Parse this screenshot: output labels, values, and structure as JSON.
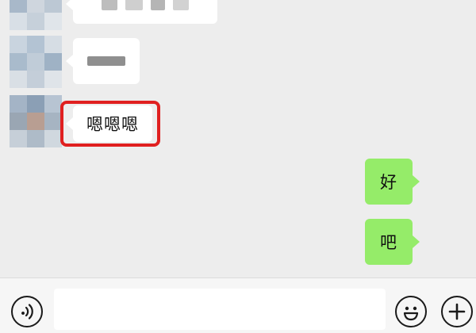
{
  "messages": [
    {
      "side": "left",
      "content": "blurred"
    },
    {
      "side": "left",
      "content": "blurred"
    },
    {
      "side": "left",
      "text": "嗯嗯嗯",
      "highlighted": true
    },
    {
      "side": "right",
      "text": "好"
    },
    {
      "side": "right",
      "text": "吧"
    }
  ],
  "input": {
    "value": "",
    "placeholder": ""
  },
  "icons": {
    "voice": "voice-icon",
    "emoji": "emoji-icon",
    "more": "plus-icon"
  },
  "colors": {
    "background": "#ededed",
    "sent_bubble": "#95ec69",
    "received_bubble": "#ffffff",
    "highlight": "#e02020"
  }
}
